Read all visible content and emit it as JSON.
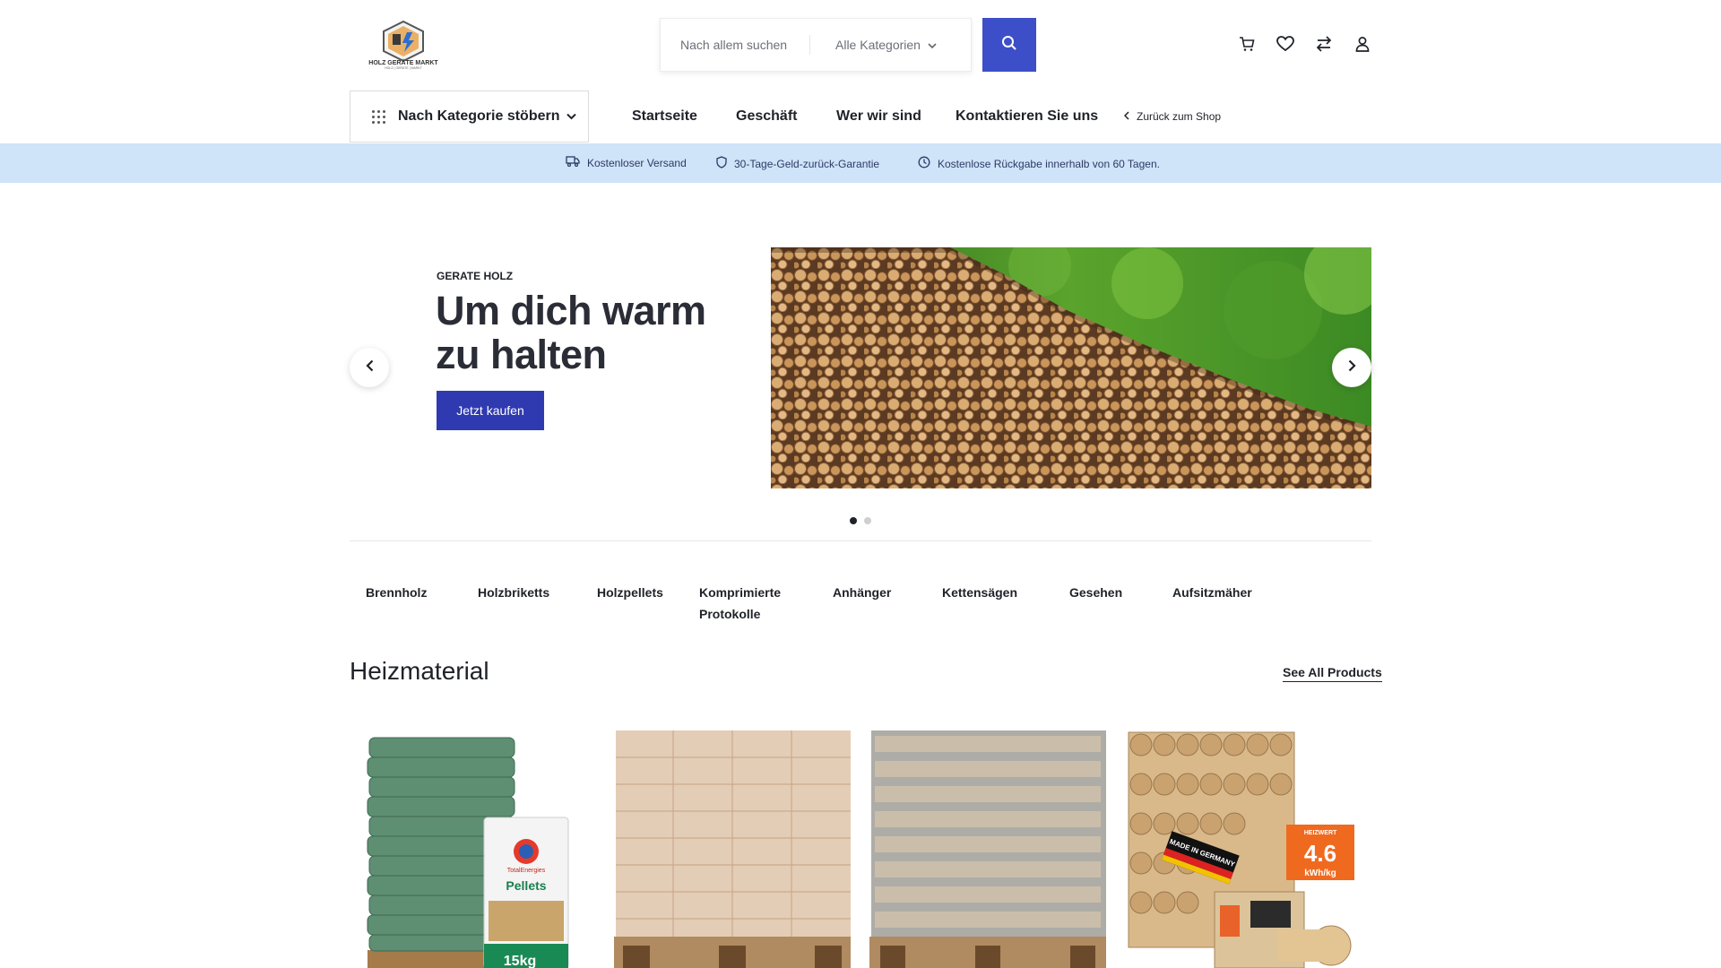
{
  "header": {
    "logo_text": "HOLZ GERÄTE MARKT",
    "logo_sub": "HOLZ | GERÄTE | MARKT",
    "search_placeholder": "Nach allem suchen",
    "category_select": "Alle Kategorien",
    "icons": [
      "cart-icon",
      "heart-icon",
      "compare-icon",
      "user-icon"
    ]
  },
  "nav": {
    "browse_label": "Nach Kategorie stöbern",
    "links": [
      "Startseite",
      "Geschäft",
      "Wer wir sind",
      "Kontaktieren Sie uns"
    ],
    "back_label": "Zurück zum Shop"
  },
  "infobar": {
    "items": [
      "Kostenloser Versand",
      "30-Tage-Geld-zurück-Garantie",
      "Kostenlose Rückgabe innerhalb von 60 Tagen."
    ]
  },
  "hero": {
    "subtitle": "GERATE HOLZ",
    "title": "Um dich warm zu halten",
    "button": "Jetzt kaufen",
    "slides_total": 2,
    "active_slide": 1
  },
  "categories": [
    "Brennholz",
    "Holzbriketts",
    "Holzpellets",
    "Komprimierte Protokolle",
    "Anhänger",
    "Kettensägen",
    "Gesehen",
    "Aufsitzmäher"
  ],
  "section": {
    "title": "Heizmaterial",
    "see_all": "See All Products"
  },
  "products": {
    "pellets_brand": "TotalEnergies",
    "pellets_name": "Pellets",
    "pellets_weight": "15kg",
    "badge_made": "MADE IN GERMANY",
    "badge_heizwert": "HEIZWERT",
    "badge_value": "4.6",
    "badge_unit": "kWh/kg"
  },
  "colors": {
    "accent": "#3c4fc8",
    "button": "#2f3ab0",
    "infobar": "#cfe3f9"
  }
}
